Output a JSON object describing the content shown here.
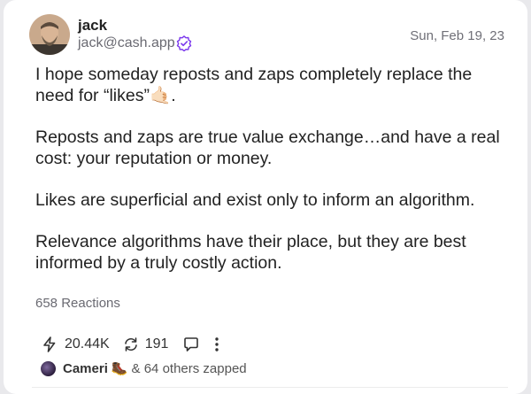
{
  "author": {
    "name": "jack",
    "handle": "jack@cash.app",
    "date": "Sun, Feb 19, 23"
  },
  "post": {
    "paragraphs": [
      "I hope someday reposts and zaps completely replace the need for “likes”🤙🏻.",
      "Reposts and zaps are true value exchange…and have a real cost: your reputation or money.",
      "Likes are superficial and exist only to inform an algorithm.",
      "Relevance algorithms have their place, but they are best informed by a truly costly action."
    ],
    "reactions": "658 Reactions"
  },
  "actions": {
    "zaps": "20.44K",
    "reposts": "191"
  },
  "zapped": {
    "name": "Cameri",
    "emoji": "🥾",
    "others": "& 64 others zapped"
  },
  "icons": {
    "zap": "lightning-icon",
    "repost": "repost-icon",
    "reply": "reply-icon",
    "more": "more-icon",
    "verified": "verified-badge-icon"
  },
  "colors": {
    "verified": "#7c3aed",
    "text": "#222222",
    "muted": "#6a6a72"
  }
}
